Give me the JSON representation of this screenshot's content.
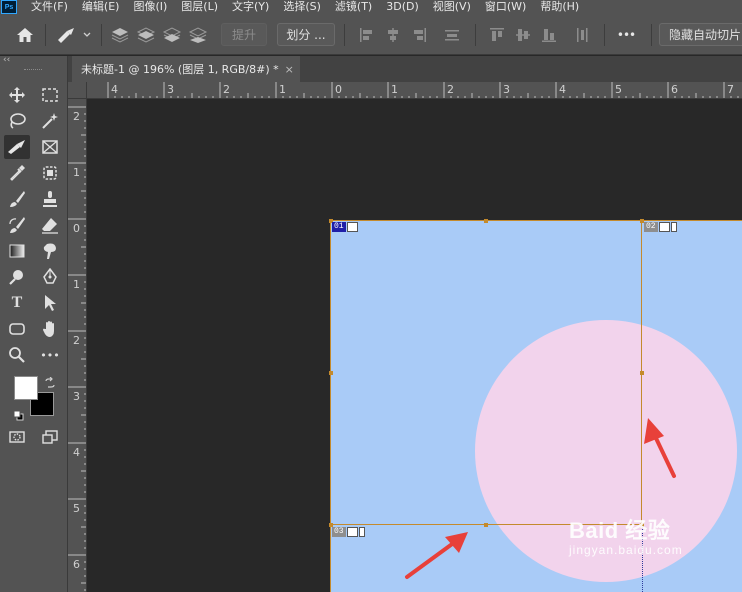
{
  "app": {
    "logo_text": "Ps"
  },
  "menu": [
    "文件(F)",
    "编辑(E)",
    "图像(I)",
    "图层(L)",
    "文字(Y)",
    "选择(S)",
    "滤镜(T)",
    "3D(D)",
    "视图(V)",
    "窗口(W)",
    "帮助(H)"
  ],
  "options_bar": {
    "promote_label": "提升",
    "divide_label": "划分 ...",
    "hide_auto_slices_label": "隐藏自动切片",
    "more_label": "•••"
  },
  "document_tab": {
    "title": "未标题-1 @ 196% (图层 1, RGB/8#) *",
    "close_label": "×"
  },
  "panel_collapse": "‹‹",
  "rulers": {
    "top": [
      "4",
      "3",
      "2",
      "1",
      "0",
      "1",
      "2",
      "3",
      "4",
      "5",
      "6",
      "7"
    ],
    "left": [
      "2",
      "1",
      "0",
      "1",
      "2",
      "3",
      "4",
      "5",
      "6"
    ]
  },
  "slices": [
    {
      "id": "01",
      "selected": true
    },
    {
      "id": "02",
      "selected": false
    },
    {
      "id": "03",
      "selected": false
    }
  ],
  "colors": {
    "foreground": "#ffffff",
    "background": "#000000",
    "canvas_blue": "#a9cbf7",
    "circle_pink": "#f2d3ec",
    "slice_line": "#c48a2c",
    "arrow_red": "#e8403a"
  },
  "tools": [
    {
      "name": "move-icon"
    },
    {
      "name": "rect-marquee-icon"
    },
    {
      "name": "lasso-icon"
    },
    {
      "name": "magic-wand-icon"
    },
    {
      "name": "slice-tool-icon",
      "active": true
    },
    {
      "name": "frame-icon"
    },
    {
      "name": "eyedropper-icon"
    },
    {
      "name": "spot-heal-icon"
    },
    {
      "name": "brush-icon"
    },
    {
      "name": "stamp-icon"
    },
    {
      "name": "history-brush-icon"
    },
    {
      "name": "eraser-icon"
    },
    {
      "name": "gradient-icon"
    },
    {
      "name": "smudge-icon"
    },
    {
      "name": "dodge-icon"
    },
    {
      "name": "pen-icon"
    },
    {
      "name": "type-icon",
      "label": "T"
    },
    {
      "name": "path-select-icon"
    },
    {
      "name": "rectangle-shape-icon"
    },
    {
      "name": "hand-icon"
    },
    {
      "name": "zoom-icon"
    },
    {
      "name": "more-tools-icon",
      "label": "•••"
    }
  ],
  "watermark": {
    "main": "Baid 经验",
    "sub": "jingyan.baidu.com"
  }
}
